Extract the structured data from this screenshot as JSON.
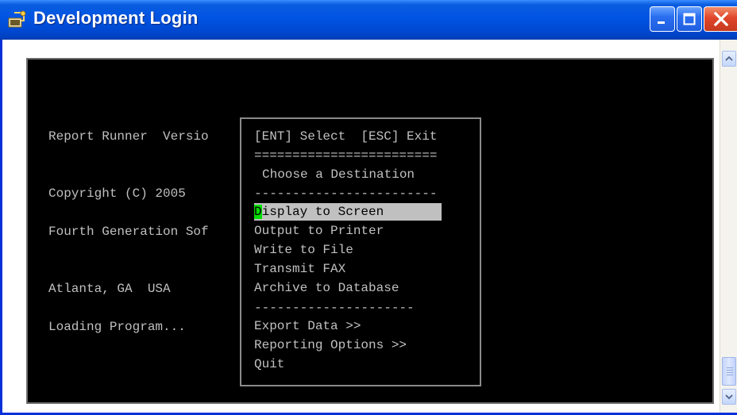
{
  "window": {
    "title": "Development Login",
    "icon": "app-window-icon",
    "controls": [
      "minimize-icon",
      "maximize-icon",
      "close-icon"
    ]
  },
  "terminal": {
    "lines": [
      "Report Runner  Versio",
      "Copyright (C) 2005",
      "Fourth Generation Sof",
      "Atlanta, GA  USA",
      "Loading Program..."
    ]
  },
  "popup": {
    "header": "[ENT] Select  [ESC] Exit",
    "double_rule": "========================",
    "heading": "Choose a Destination",
    "single_rule": "------------------------",
    "items": [
      {
        "hotkey": "D",
        "rest": "isplay to Screen",
        "selected": true
      },
      {
        "hotkey": "",
        "rest": "Output to Printer",
        "selected": false
      },
      {
        "hotkey": "",
        "rest": "Write to File",
        "selected": false
      },
      {
        "hotkey": "",
        "rest": "Transmit FAX",
        "selected": false
      },
      {
        "hotkey": "",
        "rest": "Archive to Database",
        "selected": false
      }
    ],
    "separator": "---------------------",
    "more_items": [
      "Export Data >>",
      "Reporting Options >>",
      "Quit"
    ]
  },
  "colors": {
    "titlebar": "#0054e3",
    "terminal_bg": "#000000",
    "terminal_fg": "#c0c0c0",
    "highlight_bg": "#c0c0c0",
    "hotkey_bg": "#00dd00"
  }
}
